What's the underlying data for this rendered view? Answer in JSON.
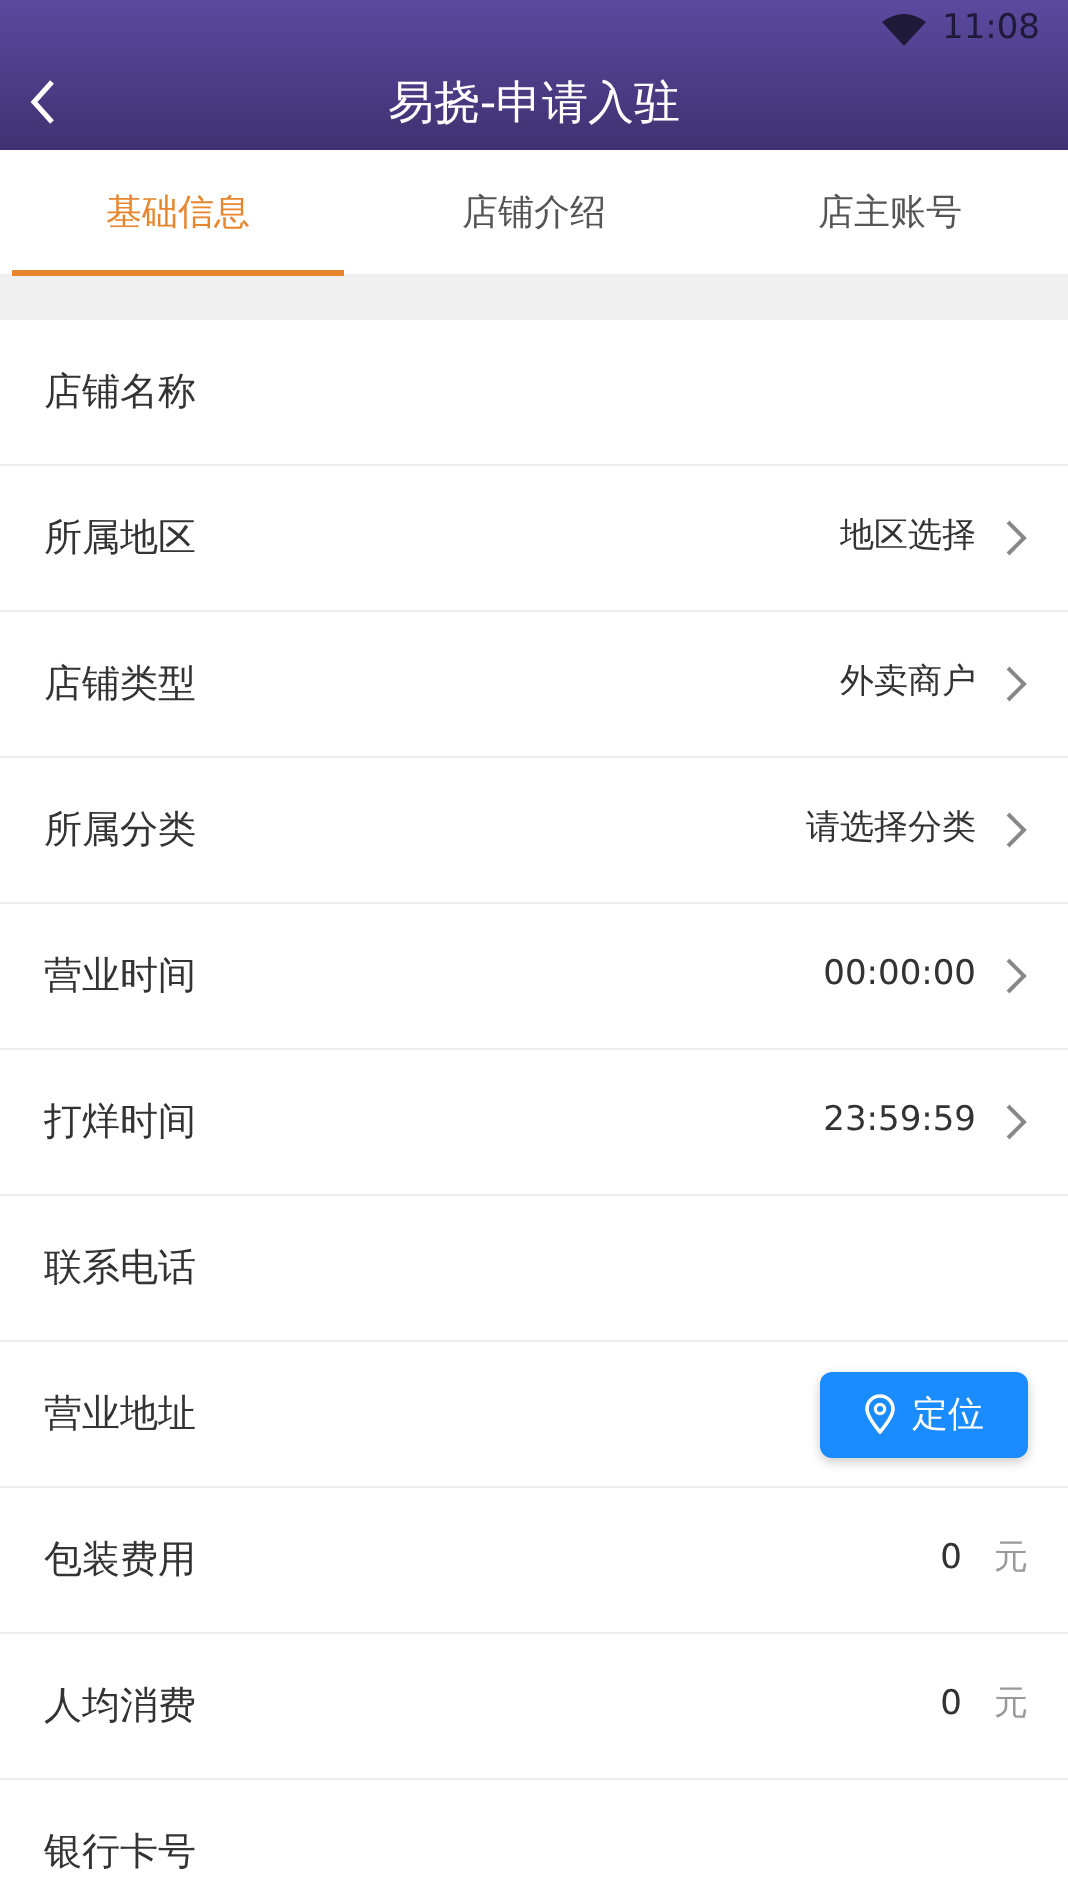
{
  "status_bar": {
    "time": "11:08"
  },
  "header": {
    "title": "易挠-申请入驻"
  },
  "tabs": [
    {
      "label": "基础信息",
      "selected": true
    },
    {
      "label": "店铺介绍",
      "selected": false
    },
    {
      "label": "店主账号",
      "selected": false
    }
  ],
  "form": [
    {
      "kind": "text",
      "label": "店铺名称"
    },
    {
      "kind": "select",
      "label": "所属地区",
      "value": "地区选择"
    },
    {
      "kind": "select",
      "label": "店铺类型",
      "value": "外卖商户"
    },
    {
      "kind": "select",
      "label": "所属分类",
      "value": "请选择分类"
    },
    {
      "kind": "select",
      "label": "营业时间",
      "value": "00:00:00"
    },
    {
      "kind": "select",
      "label": "打烊时间",
      "value": "23:59:59"
    },
    {
      "kind": "text",
      "label": "联系电话"
    },
    {
      "kind": "locate",
      "label": "营业地址",
      "button": "定位"
    },
    {
      "kind": "amount",
      "label": "包装费用",
      "value": "0",
      "unit": "元"
    },
    {
      "kind": "amount",
      "label": "人均消费",
      "value": "0",
      "unit": "元"
    },
    {
      "kind": "text",
      "label": "银行卡号"
    }
  ]
}
